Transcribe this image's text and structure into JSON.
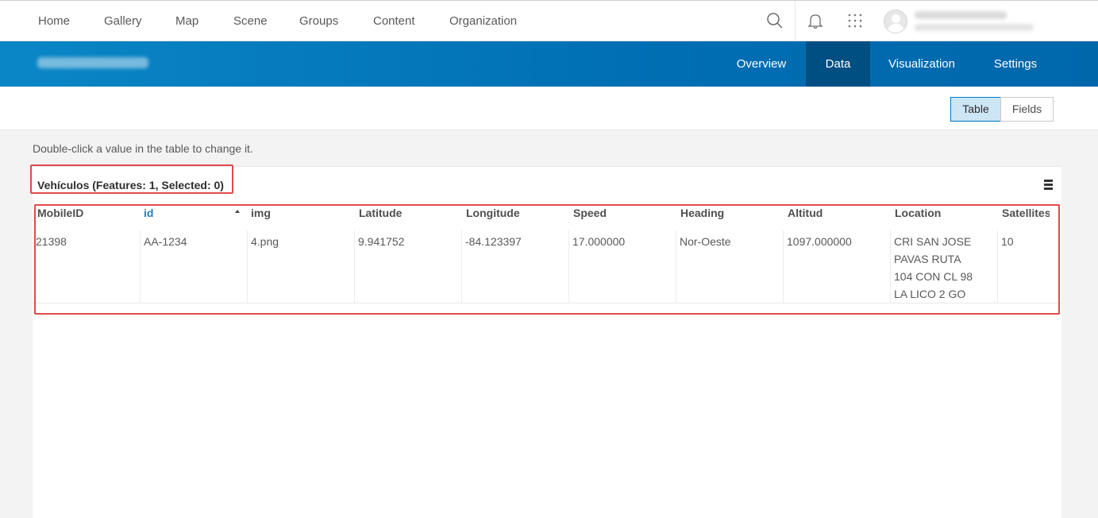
{
  "topnav": {
    "links": [
      "Home",
      "Gallery",
      "Map",
      "Scene",
      "Groups",
      "Content",
      "Organization"
    ],
    "icons": [
      "search-icon",
      "bell-icon",
      "apps-grid-icon"
    ]
  },
  "header": {
    "tabs": [
      "Overview",
      "Data",
      "Visualization",
      "Settings"
    ],
    "active_tab": "Data"
  },
  "toolbar": {
    "view_toggle": [
      "Table",
      "Fields"
    ],
    "active_view": "Table"
  },
  "hint": "Double-click a value in the table to change it.",
  "table": {
    "title": "Vehículos (Features: 1, Selected: 0)",
    "columns": [
      "MobileID",
      "id",
      "img",
      "Latitude",
      "Longitude",
      "Speed",
      "Heading",
      "Altitud",
      "Location",
      "Satellites"
    ],
    "sorted_column": "id",
    "rows": [
      [
        "21398",
        "AA-1234",
        "4.png",
        "9.941752",
        "-84.123397",
        "17.000000",
        "Nor-Oeste",
        "1097.000000",
        "CRI SAN JOSE PAVAS RUTA 104 CON CL 98 LA LICO 2 GO",
        "10"
      ]
    ]
  },
  "colors": {
    "header_blue": "#0079c1",
    "active_tab": "#004f82",
    "highlight_red": "#e04b4b",
    "sorted_header": "#2a7ab8"
  }
}
